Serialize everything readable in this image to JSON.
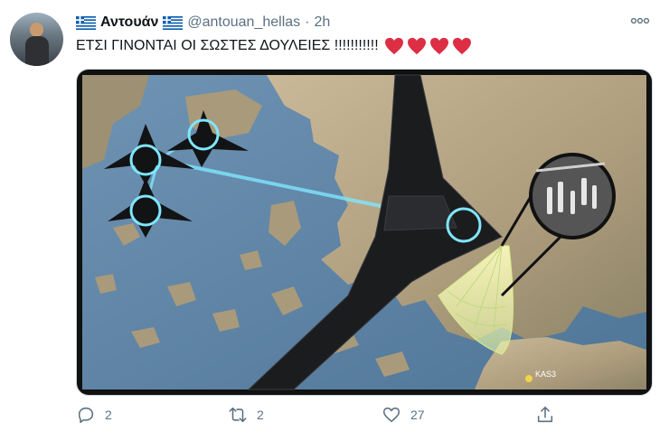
{
  "tweet": {
    "author_name": "Αντουάν",
    "handle": "@antouan_hellas",
    "separator": "·",
    "time": "2h",
    "text": "ΕΤΣΙ ΓΙΝΟΝΤΑΙ ΟΙ ΣΩΣΤΕΣ ΔΟΥΛΕΙΕΣ !!!!!!!!!!!",
    "emoji_hearts": 4
  },
  "media": {
    "map_label": "KAS3",
    "description_icons": [
      "jet-icon",
      "drone-icon",
      "radar-cone-icon",
      "ships-zoom-icon"
    ]
  },
  "actions": {
    "reply_count": "2",
    "retweet_count": "2",
    "like_count": "27"
  },
  "colors": {
    "accent_link": "#1d9bf0",
    "muted_text": "#5b7083",
    "heart_red": "#e0245e",
    "sea": "#5f86a8",
    "land": "#b8a88a",
    "link_line": "#7fe6ff"
  }
}
